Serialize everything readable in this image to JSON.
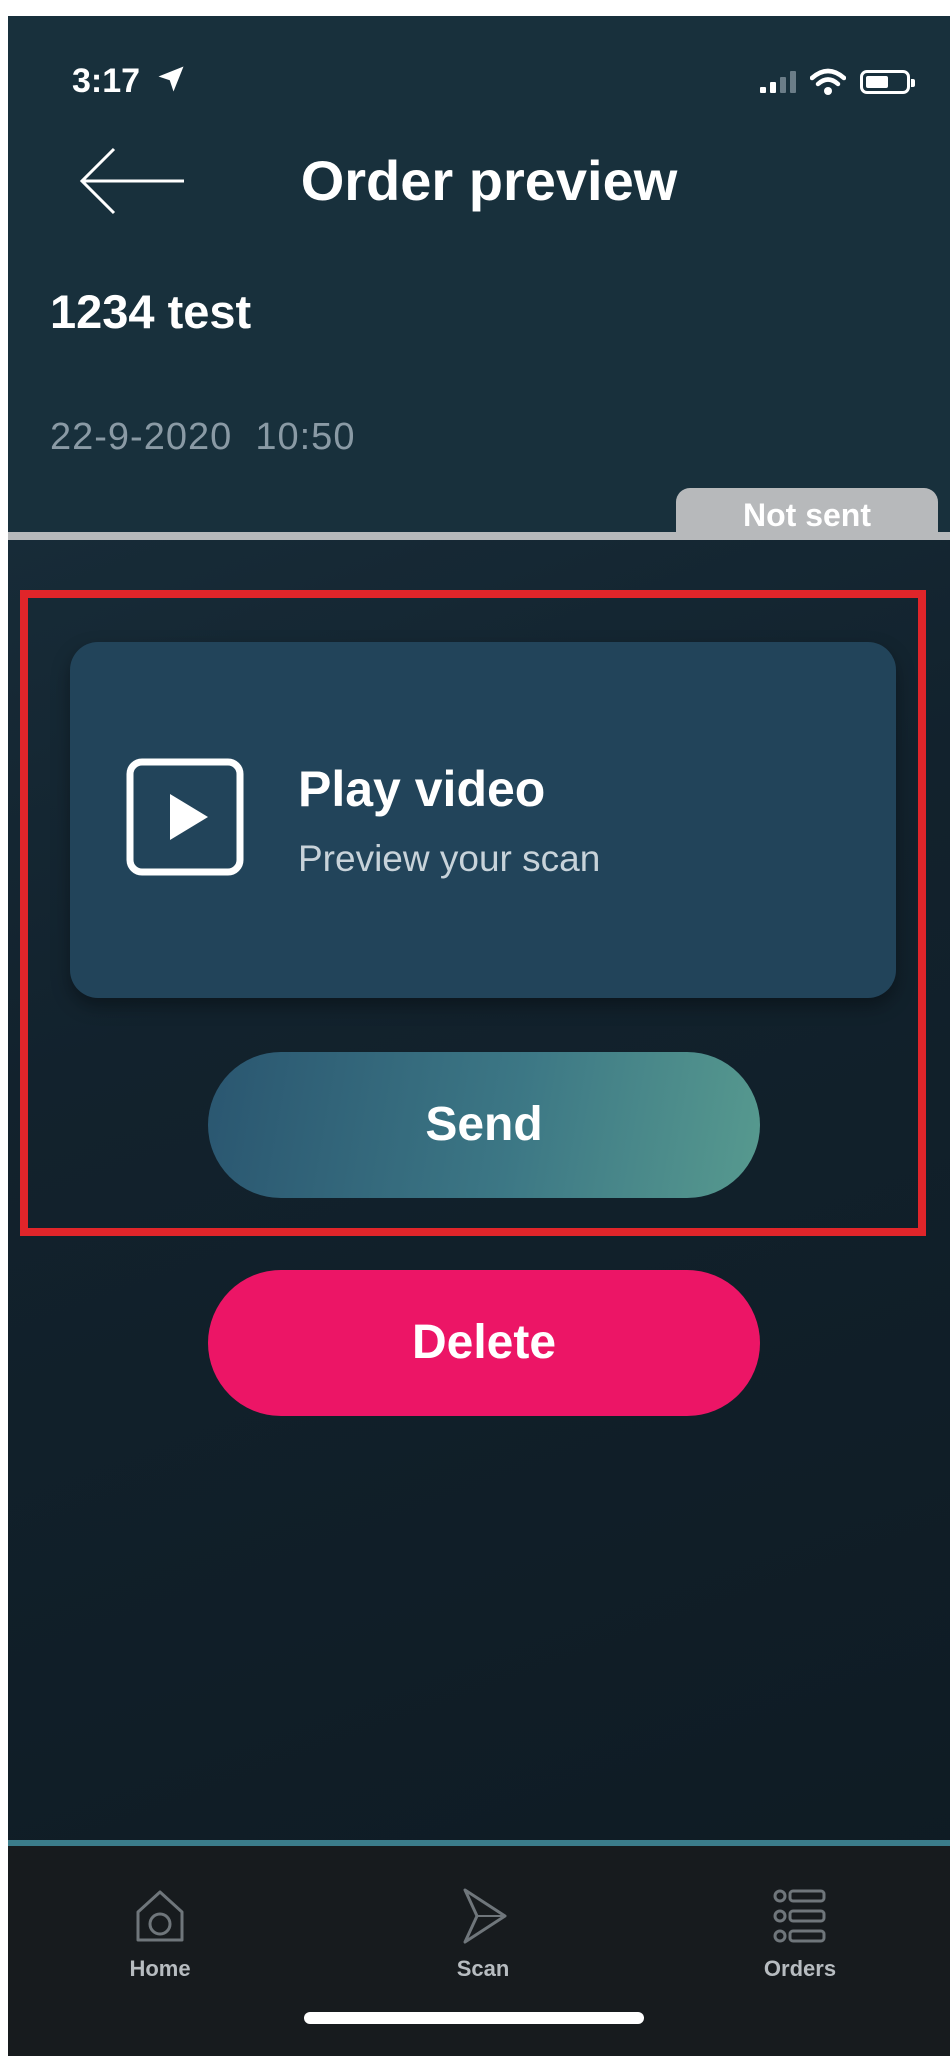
{
  "status_bar": {
    "time": "3:17"
  },
  "header": {
    "title": "Order preview"
  },
  "order": {
    "name": "1234 test",
    "date": "22-9-2020  10:50",
    "status": "Not sent"
  },
  "video_card": {
    "title": "Play video",
    "subtitle": "Preview your scan"
  },
  "actions": {
    "send_label": "Send",
    "delete_label": "Delete"
  },
  "bottom_nav": {
    "items": [
      {
        "label": "Home",
        "icon": "home-icon"
      },
      {
        "label": "Scan",
        "icon": "scan-icon"
      },
      {
        "label": "Orders",
        "icon": "orders-icon"
      }
    ]
  },
  "colors": {
    "background": "#12222d",
    "card": "#22445a",
    "delete": "#ec1566",
    "send_gradient_start": "#2a5670",
    "send_gradient_end": "#579a8f",
    "highlight": "#e0252a",
    "status_tab": "#b7b9bb"
  }
}
